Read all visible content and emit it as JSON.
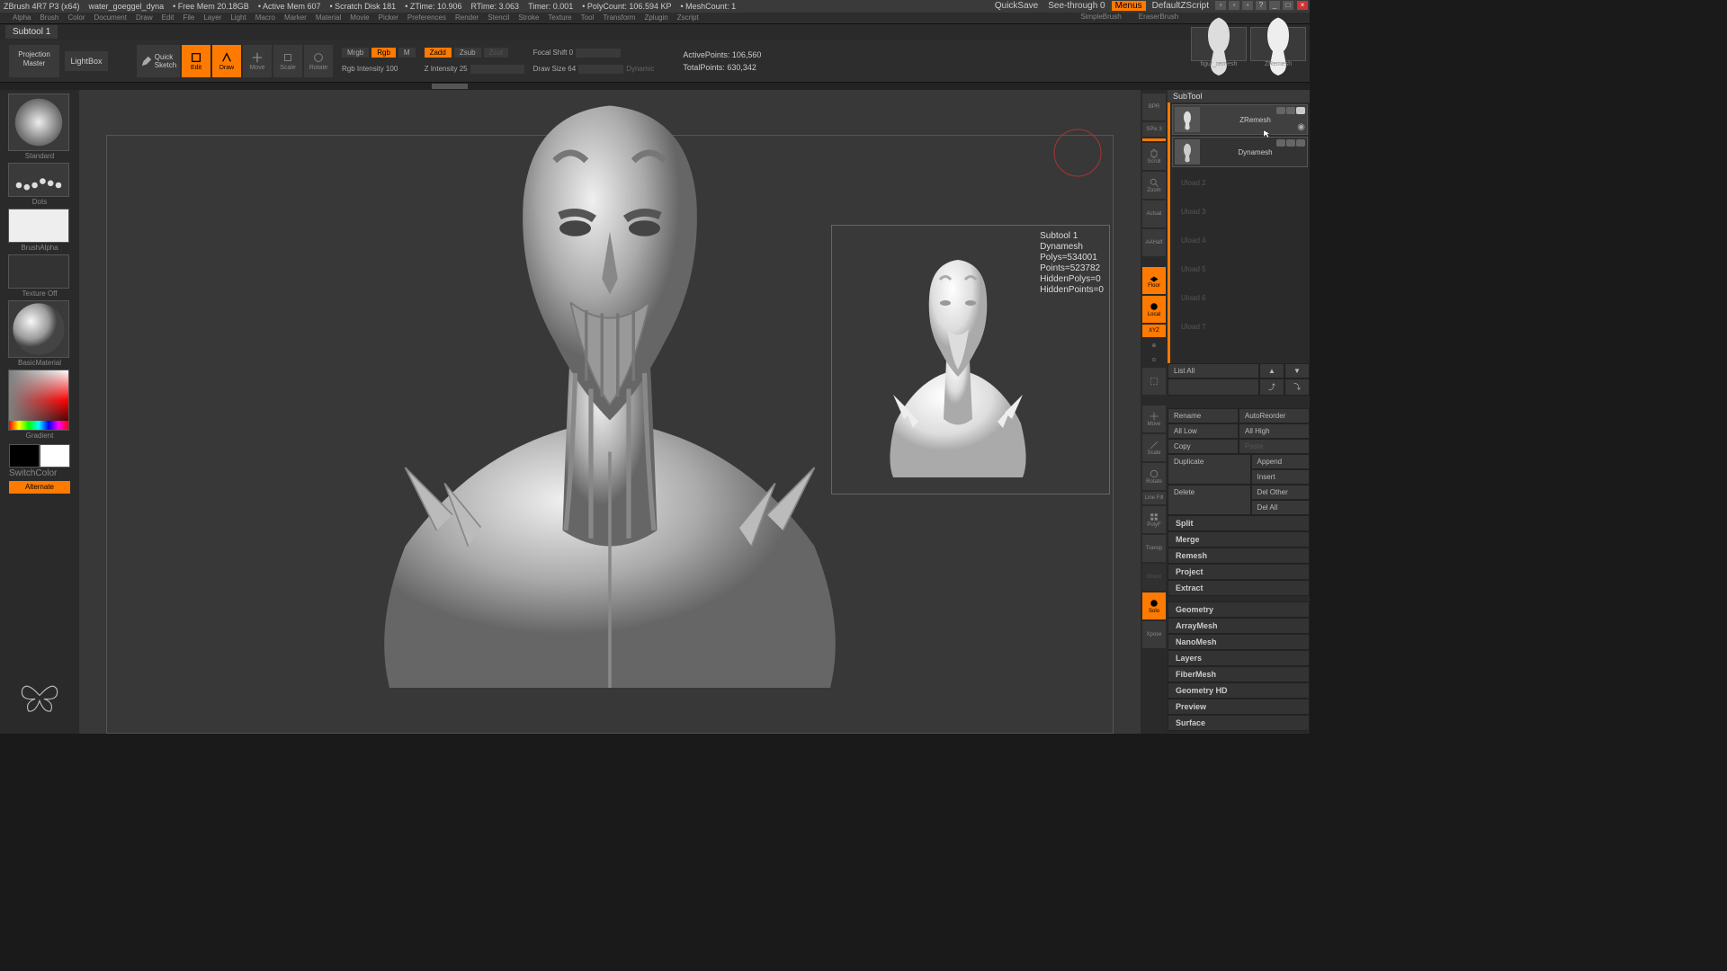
{
  "title": {
    "app": "ZBrush 4R7 P3 (x64)",
    "doc": "water_goeggel_dyna",
    "freemem": "• Free Mem 20.18GB",
    "activemem": "• Active Mem 607",
    "scratch": "• Scratch Disk 181",
    "ztime": "• ZTime: 10.906",
    "rtime": "RTime: 3.063",
    "timer": "Timer: 0.001",
    "polycount": "• PolyCount: 106.594 KP",
    "meshcount": "• MeshCount: 1"
  },
  "topright": {
    "quicksave": "QuickSave",
    "seethrough": "See-through  0",
    "menus": "Menus",
    "script": "DefaultZScript"
  },
  "brushpair": {
    "left": "figur_remesh",
    "right": "ZRemesh"
  },
  "menus": [
    "Alpha",
    "Brush",
    "Color",
    "Document",
    "Draw",
    "Edit",
    "File",
    "Layer",
    "Light",
    "Macro",
    "Marker",
    "Material",
    "Movie",
    "Picker",
    "Preferences",
    "Render",
    "Stencil",
    "Stroke",
    "Texture",
    "Tool",
    "Transform",
    "Zplugin",
    "Zscript"
  ],
  "subtoolLabel": "Subtool 1",
  "shelf": {
    "projection": "Projection\nMaster",
    "lightbox": "LightBox",
    "quicksketch": "Quick\nSketch",
    "modes": [
      "Edit",
      "Draw",
      "Move",
      "Scale",
      "Rotate"
    ],
    "mrgb": "Mrgb",
    "rgb": "Rgb",
    "m": "M",
    "rgbint": "Rgb Intensity 100",
    "zadd": "Zadd",
    "zsub": "Zsub",
    "zcut": "Zcut",
    "zint": "Z Intensity 25",
    "focal": "Focal Shift 0",
    "draw": "Draw Size 64",
    "dyn": "Dynamic",
    "active": "ActivePoints: 106,560",
    "total": "TotalPoints: 630,342"
  },
  "left": {
    "brush": "Standard",
    "stroke": "Dots",
    "alpha": "BrushAlpha",
    "tex": "Texture Off",
    "mat": "BasicMaterial",
    "gradient": "Gradient",
    "switch": "SwitchColor",
    "alternate": "Alternate"
  },
  "inset": {
    "l1": "Subtool 1",
    "l2": "Dynamesh",
    "l3": "Polys=534001",
    "l4": "Points=523782",
    "l5": "HiddenPolys=0",
    "l6": "HiddenPoints=0"
  },
  "rshelf": [
    "BPR",
    "SPix 3",
    "Scroll",
    "Zoom",
    "Actual",
    "AAHalf",
    "Floor",
    "Local",
    "XYZ",
    "",
    "",
    "",
    "Move",
    "Scale",
    "Rotate",
    "Line Fill",
    "PolyF",
    "Transp",
    "Ghost",
    "Solo",
    "Xpose"
  ],
  "subtoolPanel": {
    "header": "SubTool",
    "items": [
      {
        "name": "ZRemesh",
        "sel": true
      },
      {
        "name": "Dynamesh",
        "sel": false
      }
    ],
    "empty": [
      "Uload 2",
      "Uload 3",
      "Uload 4",
      "Uload 5",
      "Uload 6",
      "Uload 7"
    ],
    "listall": "List All",
    "btns": {
      "rename": "Rename",
      "autoreorder": "AutoReorder",
      "alllow": "All Low",
      "allhigh": "All High",
      "copy": "Copy",
      "paste": "Paste",
      "duplicate": "Duplicate",
      "append": "Append",
      "insert": "Insert",
      "delete": "Delete",
      "delother": "Del Other",
      "delall": "Del All"
    },
    "sections": [
      "Split",
      "Merge",
      "Remesh",
      "Project",
      "Extract",
      "Geometry",
      "ArrayMesh",
      "NanoMesh",
      "Layers",
      "FiberMesh",
      "Geometry HD",
      "Preview",
      "Surface"
    ]
  },
  "rbrush": {
    "simple": "SimpleBrush",
    "eraser": "EraserBrush"
  }
}
